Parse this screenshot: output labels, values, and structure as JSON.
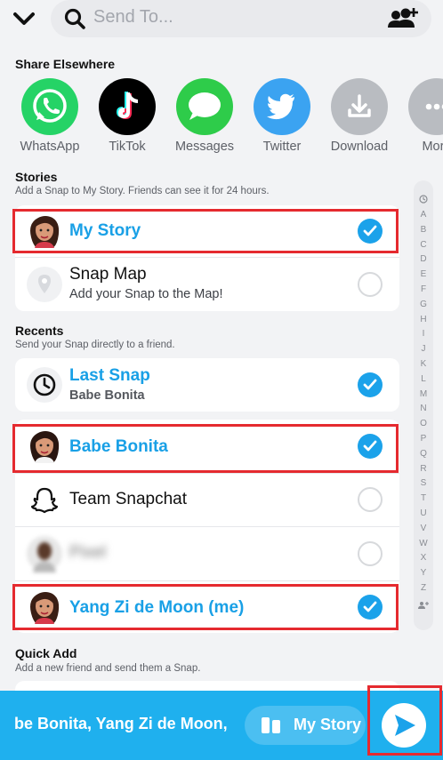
{
  "search": {
    "placeholder": "Send To..."
  },
  "share_elsewhere": {
    "title": "Share Elsewhere",
    "apps": [
      {
        "label": "WhatsApp",
        "icon": "whatsapp-icon",
        "color": "#25d366"
      },
      {
        "label": "TikTok",
        "icon": "tiktok-icon",
        "color": "#000000"
      },
      {
        "label": "Messages",
        "icon": "messages-icon",
        "color": "#2ecc4a"
      },
      {
        "label": "Twitter",
        "icon": "twitter-icon",
        "color": "#3ba3f1"
      },
      {
        "label": "Download",
        "icon": "download-icon",
        "color": "#b9bcc1"
      },
      {
        "label": "More",
        "icon": "more-icon",
        "color": "#b9bcc1"
      }
    ]
  },
  "stories": {
    "title": "Stories",
    "subtitle": "Add a Snap to My Story. Friends can see it for 24 hours.",
    "items": [
      {
        "name": "My Story",
        "selected": true
      },
      {
        "name": "Snap Map",
        "detail": "Add your Snap to the Map!",
        "selected": false
      }
    ]
  },
  "recents": {
    "title": "Recents",
    "subtitle": "Send your Snap directly to a friend.",
    "last_snap": {
      "name": "Last Snap",
      "detail": "Babe Bonita",
      "selected": true
    },
    "friends": [
      {
        "name": "Babe Bonita",
        "selected": true
      },
      {
        "name": "Team Snapchat",
        "selected": false
      },
      {
        "name": "Pixel",
        "selected": false
      },
      {
        "name": "Yang Zi de Moon (me)",
        "selected": true
      }
    ]
  },
  "quick_add": {
    "title": "Quick Add",
    "subtitle": "Add a new friend and send them a Snap."
  },
  "alphabet": [
    "A",
    "B",
    "C",
    "D",
    "E",
    "F",
    "G",
    "H",
    "I",
    "J",
    "K",
    "L",
    "M",
    "N",
    "O",
    "P",
    "Q",
    "R",
    "S",
    "T",
    "U",
    "V",
    "W",
    "X",
    "Y",
    "Z"
  ],
  "bottom_bar": {
    "recipients": "be Bonita, Yang Zi de Moon,",
    "story_label": "My Story"
  },
  "colors": {
    "accent": "#1ba2ea",
    "highlight": "#e52a2f",
    "bar": "#1fb0ee"
  }
}
